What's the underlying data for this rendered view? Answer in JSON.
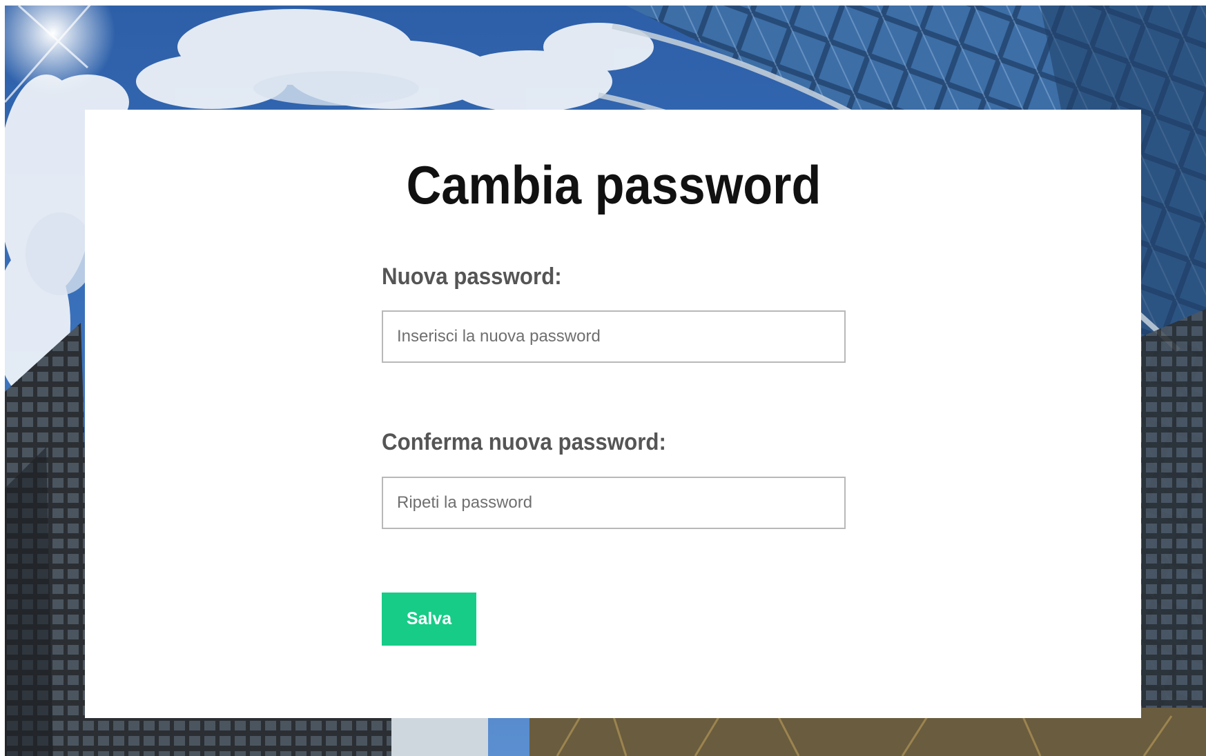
{
  "page": {
    "title": "Cambia password"
  },
  "form": {
    "new_password": {
      "label": "Nuova password:",
      "placeholder": "Inserisci la nuova password",
      "value": ""
    },
    "confirm_password": {
      "label": "Conferma nuova password:",
      "placeholder": "Ripeti la password",
      "value": ""
    },
    "save_label": "Salva"
  },
  "colors": {
    "accent": "#16cc87",
    "title": "#111111",
    "label": "#555555",
    "field_border": "#b8b8b8",
    "card": "#ffffff"
  }
}
